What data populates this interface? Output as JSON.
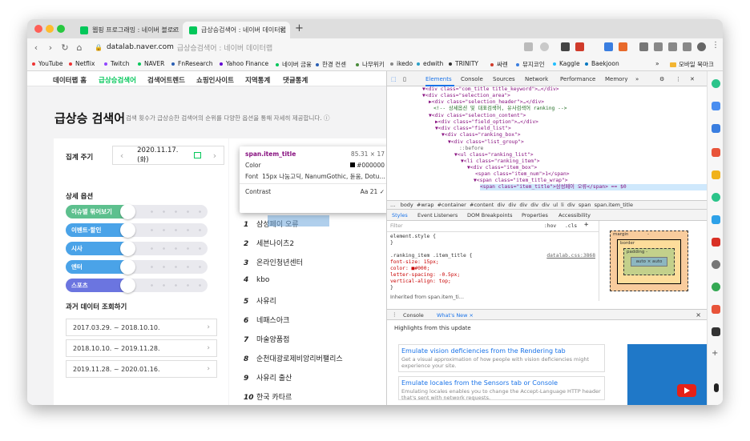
{
  "browser": {
    "tabs": [
      {
        "title": "웹핑 프로그래밍 : 네이버 블로그",
        "close": "×",
        "fav_color": "#03c75a"
      },
      {
        "title": "급상승검색어 : 네이버 데이터랩",
        "close": "×",
        "fav_color": "#03c75a"
      }
    ],
    "new_tab": "+",
    "url_host": "datalab.naver.com",
    "url_rest": "급상승검색어 : 네이버 데이터랩",
    "nav": {
      "back": "‹",
      "forward": "›",
      "reload": "↻",
      "home": "⌂"
    },
    "bookmarks": [
      "YouTube",
      "Netflix",
      "Twitch",
      "NAVER",
      "FnResearch",
      "Yahoo Finance",
      "네이버 금융",
      "한경 컨센",
      "나무위키",
      "ikedo",
      "edwith",
      "TRINITY",
      "싸렌",
      "뮤지코인",
      "Kaggle",
      "Baekjoon"
    ],
    "bookmark_more": "»",
    "mobile_bookmarks": "모바일 북마크"
  },
  "page": {
    "nav": [
      "데이터랩 홈",
      "급상승검색어",
      "검색어트렌드",
      "쇼핑인사이트",
      "지역통계",
      "댓글통계"
    ],
    "active_nav": 1,
    "title": "급상승 검색어",
    "desc": "검색 횟수가 급상승한 검색어의 순위를 다양한 옵션을 통해 자세히 제공합니다.",
    "info_icon": "ⓘ",
    "period_label": "집계 주기",
    "date": "2020.11.17. (화)",
    "prev": "‹",
    "next": "›",
    "detail_label": "상세 옵션",
    "options": [
      {
        "label": "이슈별 묶어보기",
        "color": "#5dc08e"
      },
      {
        "label": "이벤트·할인",
        "color": "#4aa3e8"
      },
      {
        "label": "시사",
        "color": "#4aa3e8"
      },
      {
        "label": "엔터",
        "color": "#4aa3e8"
      },
      {
        "label": "스포츠",
        "color": "#6b75e0"
      }
    ],
    "past_label": "과거 데이터 조회하기",
    "past": [
      "2017.03.29. ~ 2018.10.10.",
      "2018.10.10. ~ 2019.11.28.",
      "2019.11.28. ~ 2020.01.16."
    ],
    "chev": "›",
    "ranking": [
      {
        "num": "1",
        "title": "삼성페이 오류"
      },
      {
        "num": "2",
        "title": "세븐나이츠2"
      },
      {
        "num": "3",
        "title": "온라인청년센터"
      },
      {
        "num": "4",
        "title": "kbo"
      },
      {
        "num": "5",
        "title": "사유리"
      },
      {
        "num": "6",
        "title": "네패스아크"
      },
      {
        "num": "7",
        "title": "마술양품점"
      },
      {
        "num": "8",
        "title": "순천대광로제비앙리버팰리스"
      },
      {
        "num": "9",
        "title": "사유리 출산"
      },
      {
        "num": "10",
        "title": "한국 카타르"
      }
    ]
  },
  "tooltip": {
    "selector": "span.item_title",
    "size": "85.31 × 17",
    "color_label": "Color",
    "color_value": "#000000",
    "font_label": "Font",
    "font_value": "15px 나눔고딕, NanumGothic, 돋움, Dotu…",
    "contrast_label": "Contrast",
    "contrast_value": "Aa 21 ✓"
  },
  "devtools": {
    "tabs": [
      "Elements",
      "Console",
      "Sources",
      "Network",
      "Performance",
      "Memory",
      "»"
    ],
    "dom": [
      {
        "i": 0,
        "t": "▼<div class=\"com_title title_keyword\">…</div>"
      },
      {
        "i": 1,
        "t": "▼<div class=\"selection_area\">"
      },
      {
        "i": 2,
        "t": "▶<div class=\"selection_header\">…</div>"
      },
      {
        "i": 2,
        "t": "<!-- 상세옵션 및 대표검색어, 유사검색어 ranking -->"
      },
      {
        "i": 2,
        "t": "▼<div class=\"selection_content\">"
      },
      {
        "i": 3,
        "t": "▶<div class=\"field_option\">…</div>"
      },
      {
        "i": 3,
        "t": "▼<div class=\"field_list\">"
      },
      {
        "i": 4,
        "t": "▼<div class=\"ranking_box\">"
      },
      {
        "i": 5,
        "t": "▼<div class=\"list_group\">"
      },
      {
        "i": 6,
        "t": "::before"
      },
      {
        "i": 6,
        "t": "▼<ul class=\"ranking_list\">"
      },
      {
        "i": 7,
        "t": "▼<li class=\"ranking_item\">"
      },
      {
        "i": 8,
        "t": "▼<div class=\"item_box\">"
      },
      {
        "i": 9,
        "t": "<span class=\"item_num\">1</span>"
      },
      {
        "i": 9,
        "t": "▼<span class=\"item_title_wrap\">"
      },
      {
        "i": 10,
        "t": "<span class=\"item_title\">삼성페이 오류</span> == $0"
      }
    ],
    "crumbs": [
      "…",
      "body",
      "#wrap",
      "#container",
      "#content",
      "div",
      "div",
      "div",
      "div",
      "div",
      "ul",
      "li",
      "div",
      "span",
      "span.item_title"
    ],
    "subtabs": [
      "Styles",
      "Event Listeners",
      "DOM Breakpoints",
      "Properties",
      "Accessibility"
    ],
    "filter": "Filter",
    "hov": ":hov",
    "cls": ".cls",
    "plus": "+",
    "styles": [
      "element.style {",
      "}",
      "",
      ".ranking_item .item_title {",
      "  font-size: 15px;",
      "  color: ■#000;",
      "  letter-spacing: -0.5px;",
      "  vertical-align: top;",
      "}",
      "",
      "Inherited from span.item_ti…"
    ],
    "source": "datalab.css:3868",
    "box": {
      "margin": "margin",
      "border": "border",
      "padding": "padding -",
      "content": "auto × auto",
      "dash": "-"
    },
    "drawer_tabs": [
      "Console",
      "What's New ×"
    ],
    "drawer_close": "×",
    "highlights": "Highlights from this update",
    "cards": [
      {
        "title": "Emulate vision deficiencies from the Rendering tab",
        "body": "Get a visual approximation of how people with vision deficiencies might experience your site."
      },
      {
        "title": "Emulate locales from the Sensors tab or Console",
        "body": "Emulating locales enables you to change the Accept-Language HTTP header that's sent with network requests."
      }
    ]
  },
  "colors": {
    "naver_green": "#03c75a",
    "link_blue": "#1a73e8",
    "highlight": "#6fa8dc"
  }
}
